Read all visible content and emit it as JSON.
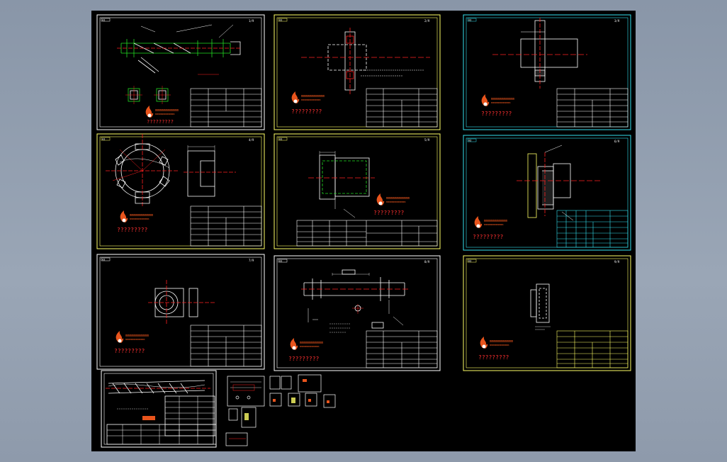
{
  "viewport": {
    "background": "#000000",
    "window_bg": "#8e9aab"
  },
  "colors": {
    "yellow": "#ffff66",
    "white": "#ffffff",
    "cyan": "#33e0ee",
    "red": "#ff2020",
    "green": "#22dd22",
    "logo_orange": "#e8541c"
  },
  "sheets": [
    {
      "id": "s1",
      "tag": "A3",
      "frame": "white",
      "marker": "1/9"
    },
    {
      "id": "s2",
      "tag": "A3",
      "frame": "yellow",
      "marker": "2/9"
    },
    {
      "id": "s3",
      "tag": "A3",
      "frame": "cyan",
      "marker": "3/9"
    },
    {
      "id": "s4",
      "tag": "A3",
      "frame": "yellow",
      "marker": "4/9"
    },
    {
      "id": "s5",
      "tag": "A3",
      "frame": "yellow",
      "marker": "5/9"
    },
    {
      "id": "s6",
      "tag": "A3",
      "frame": "cyan",
      "marker": "6/9"
    },
    {
      "id": "s7",
      "tag": "A3",
      "frame": "white",
      "marker": "7/9"
    },
    {
      "id": "s8",
      "tag": "A3",
      "frame": "white",
      "marker": "8/9"
    },
    {
      "id": "s9",
      "tag": "A3",
      "frame": "yellow",
      "marker": "9/9"
    }
  ],
  "company_text": "?????????",
  "logo_text": "mmmmmmmmmmm",
  "logo_subtext": "mmmmmmmmmmmmm"
}
